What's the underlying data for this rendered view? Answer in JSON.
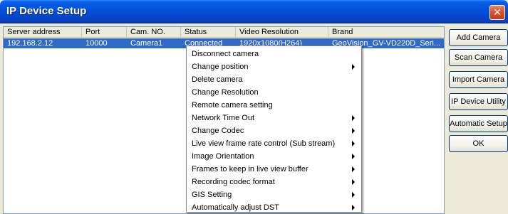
{
  "window": {
    "title": "IP Device Setup",
    "close_icon": "close-icon"
  },
  "table": {
    "columns": [
      "Server address",
      "Port",
      "Cam. NO.",
      "Status",
      "Video Resolution",
      "Brand"
    ],
    "rows": [
      {
        "server_address": "192.168.2.12",
        "port": "10000",
        "cam_no": "Camera1",
        "status": "Connected",
        "video_resolution": "1920x1080(H264)",
        "brand": "GeoVision_GV-VD220D_Seri..."
      }
    ]
  },
  "side_buttons": {
    "add_camera": "Add Camera",
    "scan_camera": "Scan Camera",
    "import_camera": "Import Camera",
    "ip_device_utility": "IP Device Utility",
    "automatic_setup": "Automatic Setup",
    "ok": "OK"
  },
  "context_menu": {
    "items": [
      {
        "label": "Disconnect camera",
        "submenu": false
      },
      {
        "label": "Change position",
        "submenu": true
      },
      {
        "label": "Delete camera",
        "submenu": false
      },
      {
        "label": "Change Resolution",
        "submenu": false
      },
      {
        "label": "Remote camera setting",
        "submenu": false
      },
      {
        "label": "Network Time Out",
        "submenu": true
      },
      {
        "label": "Change Codec",
        "submenu": true
      },
      {
        "label": "Live view frame rate control (Sub stream)",
        "submenu": true
      },
      {
        "label": "Image Orientation",
        "submenu": true
      },
      {
        "label": "Frames to keep in live view buffer",
        "submenu": true
      },
      {
        "label": "Recording codec format",
        "submenu": true
      },
      {
        "label": "GIS Setting",
        "submenu": true
      },
      {
        "label": "Automatically adjust DST",
        "submenu": true
      }
    ]
  },
  "colors": {
    "title_bar": "#0453dc",
    "selection": "#316ac5",
    "window_bg": "#ece9d8",
    "close_button": "#d9542e"
  }
}
